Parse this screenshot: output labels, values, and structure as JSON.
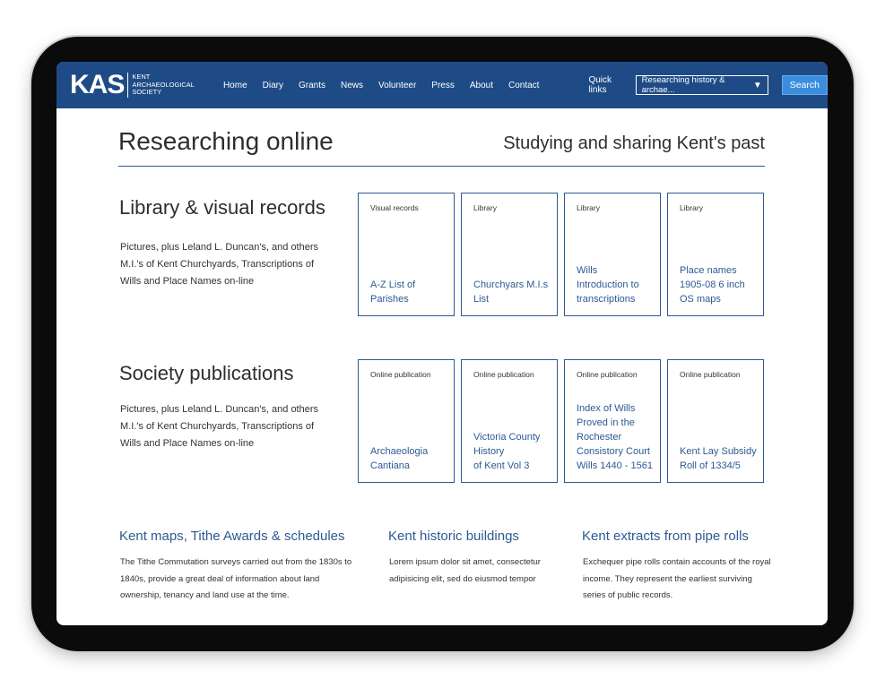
{
  "nav": {
    "logo_mark": "KAS",
    "logo_words": [
      "KENT",
      "ARCHAEOLOGICAL",
      "SOCIETY"
    ],
    "links": [
      "Home",
      "Diary",
      "Grants",
      "News",
      "Volunteer",
      "Press",
      "About",
      "Contact"
    ],
    "quick_links_label": "Quick links",
    "quick_select_value": "Researching history & archae...",
    "search_label": "Search"
  },
  "header": {
    "title": "Researching online",
    "tagline": "Studying and sharing Kent's past"
  },
  "sections": [
    {
      "title": "Library & visual records",
      "description": "Pictures, plus Leland L. Duncan's, and others M.I.'s of Kent Churchyards, Transcriptions of Wills and Place Names on-line",
      "cards": [
        {
          "category": "Visual records",
          "title": "A-Z List of\nParishes"
        },
        {
          "category": "Library",
          "title": "Churchyars M.I.s\nList"
        },
        {
          "category": "Library",
          "title": "Wills\nIntroduction to\ntranscriptions"
        },
        {
          "category": "Library",
          "title": "Place names\n1905-08 6 inch\nOS maps"
        }
      ]
    },
    {
      "title": "Society publications",
      "description": "Pictures, plus Leland L. Duncan's, and others M.I.'s of Kent Churchyards, Transcriptions of Wills and Place Names on-line",
      "cards": [
        {
          "category": "Online publication",
          "title": "Archaeologia\nCantiana"
        },
        {
          "category": "Online publication",
          "title": "Victoria County\nHistory\nof Kent Vol 3"
        },
        {
          "category": "Online publication",
          "title": "Index of Wills\nProved in the\nRochester\nConsistory Court\nWills 1440 - 1561"
        },
        {
          "category": "Online publication",
          "title": "Kent Lay Subsidy\nRoll of 1334/5"
        }
      ]
    }
  ],
  "bottom": [
    {
      "title": "Kent maps, Tithe Awards & schedules",
      "text": "The Tithe Commutation surveys carried out from the 1830s to 1840s, provide a great deal of information about land ownership, tenancy and land use at the time."
    },
    {
      "title": "Kent historic buildings",
      "text": "Lorem ipsum dolor sit amet, consectetur adipisicing elit, sed do eiusmod tempor"
    },
    {
      "title": "Kent extracts from pipe rolls",
      "text": "Exchequer pipe rolls contain accounts of the royal income. They represent the earliest surviving series of public records."
    }
  ],
  "colors": {
    "nav_bg": "#1e4b86",
    "accent": "#2d5a92",
    "search_btn": "#3b8ede"
  }
}
